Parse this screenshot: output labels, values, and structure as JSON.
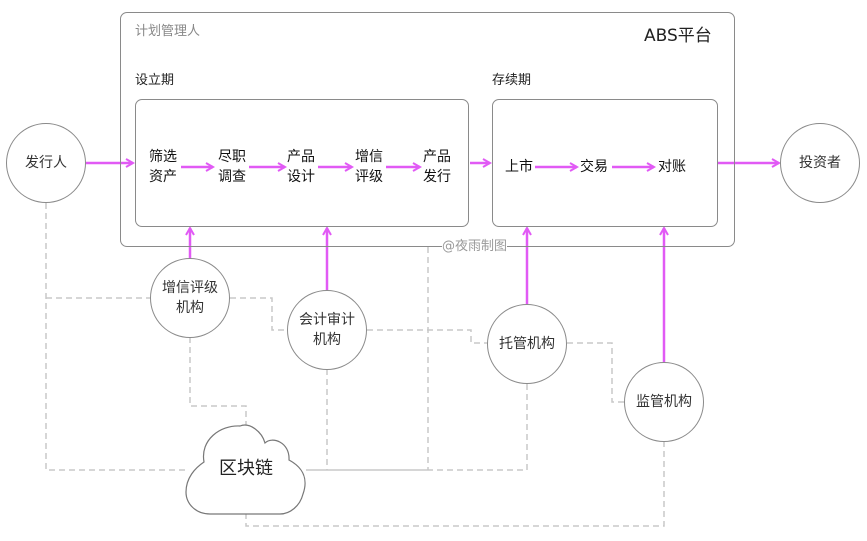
{
  "platform": {
    "title": "ABS平台",
    "manager_label": "计划管理人"
  },
  "phases": {
    "setup": {
      "title": "设立期",
      "steps": [
        {
          "line1": "筛选",
          "line2": "资产"
        },
        {
          "line1": "尽职",
          "line2": "调查"
        },
        {
          "line1": "产品",
          "line2": "设计"
        },
        {
          "line1": "增信",
          "line2": "评级"
        },
        {
          "line1": "产品",
          "line2": "发行"
        }
      ]
    },
    "duration": {
      "title": "存续期",
      "steps": [
        "上市",
        "交易",
        "对账"
      ]
    }
  },
  "nodes": {
    "issuer": "发行人",
    "investor": "投资者",
    "rating": {
      "line1": "增信评级",
      "line2": "机构"
    },
    "audit": {
      "line1": "会计审计",
      "line2": "机构"
    },
    "custody": "托管机构",
    "regulator": "监管机构",
    "blockchain": "区块链"
  },
  "watermark": "@夜雨制图",
  "colors": {
    "flow_arrow": "#e15af5",
    "dashed_link": "#c8c8c8",
    "border": "#8a8a8a"
  }
}
